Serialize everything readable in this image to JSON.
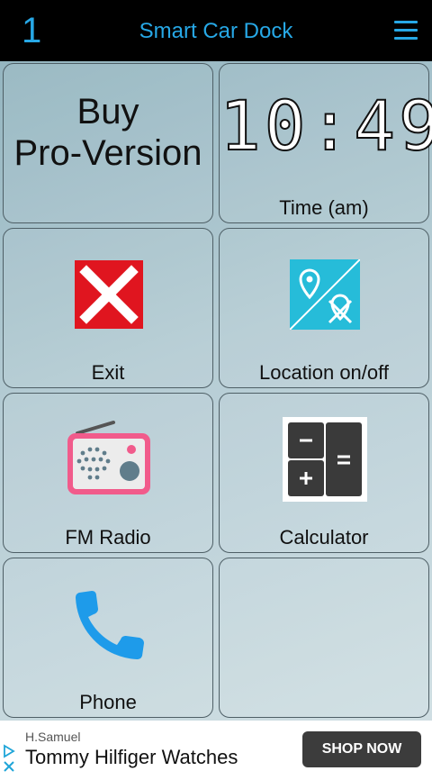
{
  "topbar": {
    "number": "1",
    "title": "Smart Car Dock"
  },
  "tiles": {
    "buy": {
      "line1": "Buy",
      "line2": "Pro-Version"
    },
    "time": {
      "clock": "10:49",
      "label": "Time (am)"
    },
    "exit": {
      "label": "Exit"
    },
    "location": {
      "label": "Location on/off"
    },
    "radio": {
      "label": "FM Radio"
    },
    "calculator": {
      "label": "Calculator"
    },
    "phone": {
      "label": "Phone"
    }
  },
  "ad": {
    "advertiser": "H.Samuel",
    "headline": "Tommy Hilfiger Watches",
    "cta": "SHOP NOW"
  },
  "colors": {
    "accent": "#27a8e6",
    "exit_red": "#e0151f",
    "location_teal": "#26bcd9",
    "radio_pink": "#f15b8b",
    "phone_blue": "#1e9bea"
  }
}
